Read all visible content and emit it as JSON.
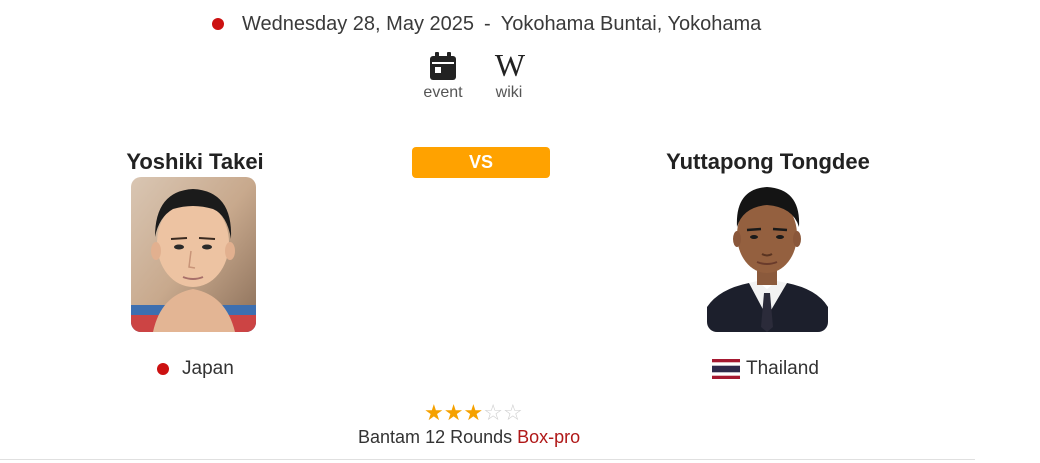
{
  "event": {
    "date": "Wednesday 28, May 2025",
    "separator": "-",
    "venue": "Yokohama Buntai, Yokohama"
  },
  "links": {
    "event_label": "event",
    "wiki_label": "wiki",
    "wiki_symbol": "W"
  },
  "vs_label": "VS",
  "fighters": {
    "left": {
      "name": "Yoshiki Takei",
      "country": "Japan",
      "flag_color": "#cc1111"
    },
    "right": {
      "name": "Yuttapong Tongdee",
      "country": "Thailand"
    }
  },
  "fight": {
    "rating": 3,
    "rating_max": 5,
    "weight_class": "Bantam",
    "rounds": "12 Rounds",
    "discipline": "Box-pro"
  },
  "colors": {
    "accent": "#ffa200",
    "star": "#f5a100",
    "discipline": "#b01818",
    "live_dot": "#cc1111"
  }
}
